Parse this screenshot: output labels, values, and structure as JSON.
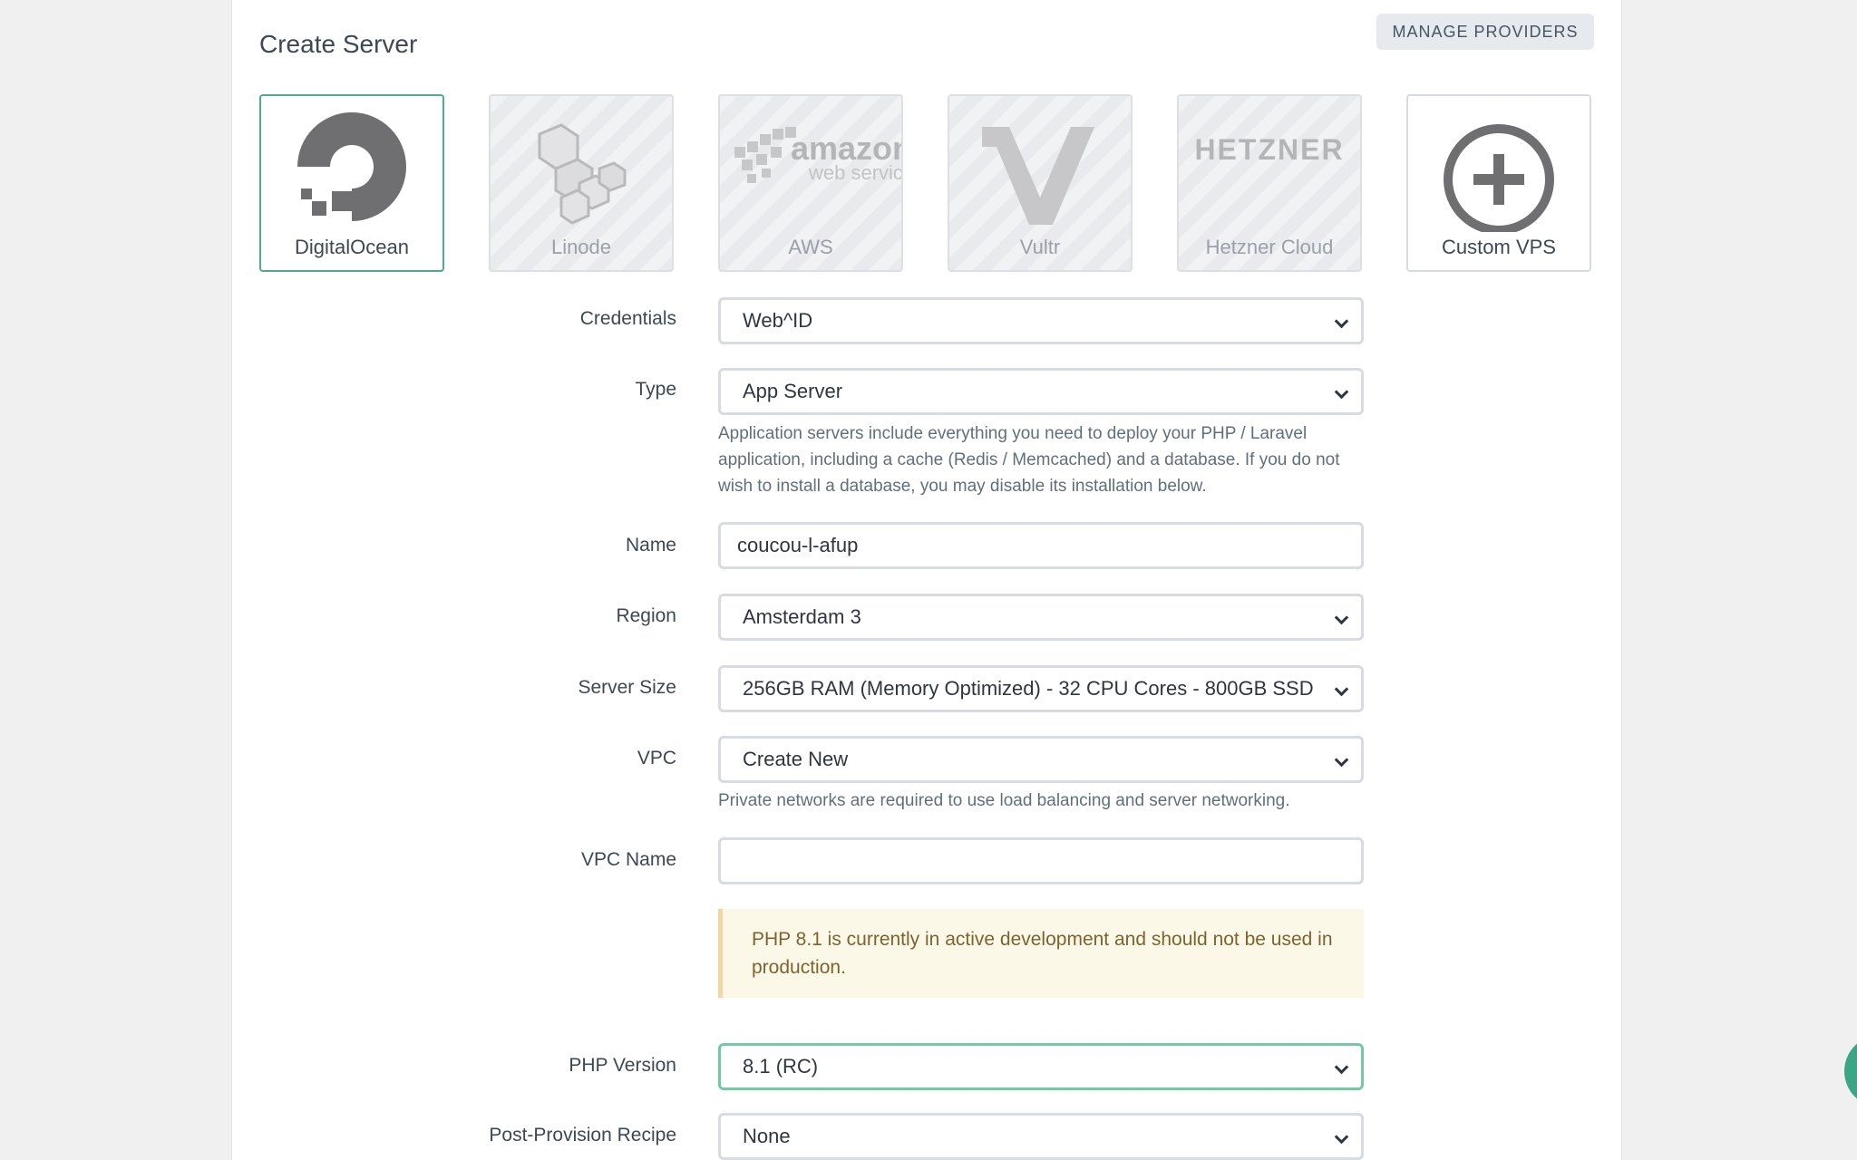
{
  "page": {
    "title": "Create Server",
    "manage_providers_label": "MANAGE PROVIDERS"
  },
  "providers": [
    {
      "label": "DigitalOcean",
      "icon": "digitalocean-logo-icon",
      "state": "selected"
    },
    {
      "label": "Linode",
      "icon": "linode-logo-icon",
      "state": "disabled"
    },
    {
      "label": "AWS",
      "icon": "aws-logo-icon",
      "logo_text": "amazon",
      "logo_subtext": "web services",
      "state": "disabled"
    },
    {
      "label": "Vultr",
      "icon": "vultr-logo-icon",
      "state": "disabled"
    },
    {
      "label": "Hetzner Cloud",
      "icon": "hetzner-logo-icon",
      "logo_text": "HETZNER",
      "state": "disabled"
    },
    {
      "label": "Custom VPS",
      "icon": "plus-circle-icon",
      "state": "available"
    }
  ],
  "form": {
    "credentials": {
      "label": "Credentials",
      "value": "Web^ID"
    },
    "type": {
      "label": "Type",
      "value": "App Server",
      "help": "Application servers include everything you need to deploy your PHP / Laravel application, including a cache (Redis / Memcached) and a database. If you do not wish to install a database, you may disable its installation below."
    },
    "name": {
      "label": "Name",
      "value": "coucou-l-afup"
    },
    "region": {
      "label": "Region",
      "value": "Amsterdam 3"
    },
    "server_size": {
      "label": "Server Size",
      "value": "256GB RAM (Memory Optimized) - 32 CPU Cores - 800GB SSD"
    },
    "vpc": {
      "label": "VPC",
      "value": "Create New",
      "help": "Private networks are required to use load balancing and server networking."
    },
    "vpc_name": {
      "label": "VPC Name",
      "value": ""
    },
    "php_alert": "PHP 8.1 is currently in active development and should not be used in production.",
    "php_version": {
      "label": "PHP Version",
      "value": "8.1 (RC)"
    },
    "post_provision": {
      "label": "Post-Provision Recipe",
      "value": "None"
    }
  },
  "colors": {
    "accent": "#52aa8a",
    "alert_bg": "#fcf8e7",
    "alert_border": "#f2d6a6"
  }
}
